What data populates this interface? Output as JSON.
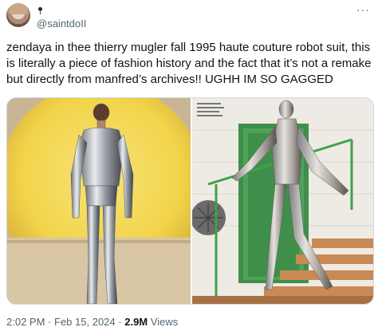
{
  "tweet": {
    "author_name": "",
    "handle": "@saintdoII",
    "text": "zendaya in thee thierry mugler fall 1995 haute couture robot suit, this is literally a piece of fashion history and the fact that it’s not a remake but directly from manfred’s archives!! UGHH IM SO GAGGED",
    "time": "2:02 PM",
    "date": "Feb 15, 2024",
    "views_count": "2.9M",
    "views_label": "Views",
    "separator": "·",
    "more_glyph": "···",
    "caption_lines": [
      "...",
      "...",
      "...",
      "..."
    ]
  },
  "icons": {
    "badge": "rose-emoji-icon",
    "more": "more-horizontal-icon"
  },
  "colors": {
    "text": "#0f1419",
    "secondary": "#536471",
    "border": "#cfd9de",
    "sun": "#f2d44a",
    "door_green": "#3f8f4a"
  }
}
